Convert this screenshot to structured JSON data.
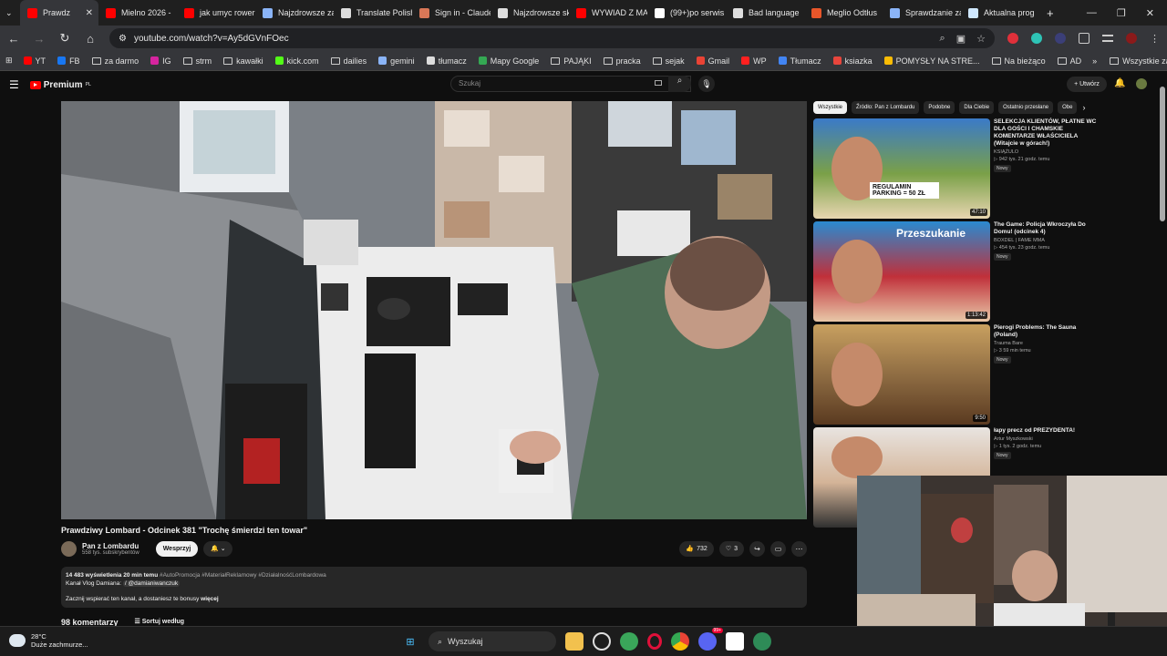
{
  "browser": {
    "tabs": [
      {
        "label": "Prawdz",
        "color": "#ff0000",
        "active": true
      },
      {
        "label": "Mielno 2026 -",
        "color": "#ff0000"
      },
      {
        "label": "jak umyc rower",
        "color": "#ff0000"
      },
      {
        "label": "Najzdrowsze za",
        "color": "#8ab4f8"
      },
      {
        "label": "Translate Polish",
        "color": "#dddddd"
      },
      {
        "label": "Sign in - Claude",
        "color": "#d97757"
      },
      {
        "label": "Najzdrowsze sk",
        "color": "#dddddd"
      },
      {
        "label": "WYWIAD Z MA",
        "color": "#ff0000"
      },
      {
        "label": "(99+)po serwis",
        "color": "#ffffff"
      },
      {
        "label": "Bad language",
        "color": "#dddddd"
      },
      {
        "label": "Meglio Odtłus",
        "color": "#e8562a"
      },
      {
        "label": "Sprawdzanie za",
        "color": "#8ab4f8"
      },
      {
        "label": "Aktualna prog",
        "color": "#cfe8ff"
      }
    ],
    "new_tab": "+",
    "url": "youtube.com/watch?v=Ay5dGVnFOec",
    "bookmarks": [
      {
        "label": "YT",
        "type": "icon",
        "color": "#ff0000"
      },
      {
        "label": "FB",
        "type": "icon",
        "color": "#1877f2"
      },
      {
        "label": "za darmo",
        "type": "folder"
      },
      {
        "label": "IG",
        "type": "icon",
        "color": "#d6249f"
      },
      {
        "label": "strm",
        "type": "folder"
      },
      {
        "label": "kawałki",
        "type": "folder"
      },
      {
        "label": "kick.com",
        "type": "icon",
        "color": "#53fc18"
      },
      {
        "label": "dailies",
        "type": "folder"
      },
      {
        "label": "gemini",
        "type": "icon",
        "color": "#8ab4f8"
      },
      {
        "label": "tłumacz",
        "type": "icon",
        "color": "#dddddd"
      },
      {
        "label": "Mapy Google",
        "type": "icon",
        "color": "#34a853"
      },
      {
        "label": "PAJĄKI",
        "type": "folder"
      },
      {
        "label": "pracka",
        "type": "folder"
      },
      {
        "label": "sejak",
        "type": "folder"
      },
      {
        "label": "Gmail",
        "type": "icon",
        "color": "#ea4335"
      },
      {
        "label": "WP",
        "type": "icon",
        "color": "#ff2020"
      },
      {
        "label": "Tłumacz",
        "type": "icon",
        "color": "#4285f4"
      },
      {
        "label": "ksiazka",
        "type": "icon",
        "color": "#e8453c"
      },
      {
        "label": "POMYSŁY NA STRE...",
        "type": "icon",
        "color": "#fbbc05"
      },
      {
        "label": "Na bieżąco",
        "type": "folder"
      },
      {
        "label": "AD",
        "type": "folder"
      }
    ],
    "all_bookmarks": "Wszystkie zakładki"
  },
  "youtube": {
    "logo_label": "Premium",
    "logo_sup": "PL",
    "search_placeholder": "Szukaj",
    "create_label": "+ Utwórz",
    "video": {
      "title": "Prawdziwy Lombard - Odcinek 381 \"Trochę śmierdzi ten towar\"",
      "channel": "Pan z Lombardu",
      "subscribers": "558 tys. subskrybentów",
      "support_label": "Wesprzyj",
      "likes": "732",
      "comments_count_badge": "3",
      "views_line": "14 483 wyświetlenia  20 min temu",
      "tags": "#AutoPromocja #MateriałReklamowy #DziałalnośćLombardowa",
      "desc_line1": "Kanał Vlog Damiana:",
      "desc_handle": "/ @damianiwanczuk",
      "desc_line2": "Zacznij wspierać ten kanał, a dostaniesz te bonusy",
      "more_label": "więcej",
      "comments_label": "98 komentarzy",
      "sort_label": "Sortuj według"
    },
    "chips": [
      "Wszystkie",
      "Źródło: Pan z Lombardu",
      "Podobne",
      "Dla Ciebie",
      "Ostatnio przesłane",
      "Obe"
    ],
    "recommendations": [
      {
        "title": "SELEKCJA KLIENTÓW, PŁATNE WC DLA GOŚCI I CHAMSKIE KOMENTARZE WŁAŚCICIELA (Witajcie w górach!)",
        "channel": "KSIĄŻULO",
        "meta": "942 tys.   21 godz. temu",
        "badge": "Nowy",
        "duration": "47:10",
        "thumb_text": "REGULAMIN PARKING = 50 ZŁ"
      },
      {
        "title": "The Game: Policja Wkroczyła Do Domu! (odcinek 4)",
        "channel": "BOXDEL | FAME MMA",
        "meta": "454 tys.   23 godz. temu",
        "badge": "Nowy",
        "duration": "1:13:42",
        "thumb_text": "Przeszukanie"
      },
      {
        "title": "Pierogi Problems: The Sauna (Poland)",
        "channel": "Trauma Bare",
        "meta": "3   59 min temu",
        "badge": "Nowy",
        "duration": "9:50",
        "thumb_text": ""
      },
      {
        "title": "łapy precz od PREZYDENTA!",
        "channel": "Artur Myszkowski",
        "meta": "1 tys.   2 godz. temu",
        "badge": "Nowy",
        "duration": "",
        "thumb_text": ""
      }
    ]
  },
  "taskbar": {
    "temp": "28°C",
    "weather": "Duże zachmurze...",
    "search_label": "Wyszukaj",
    "notif_badge": "99+"
  }
}
